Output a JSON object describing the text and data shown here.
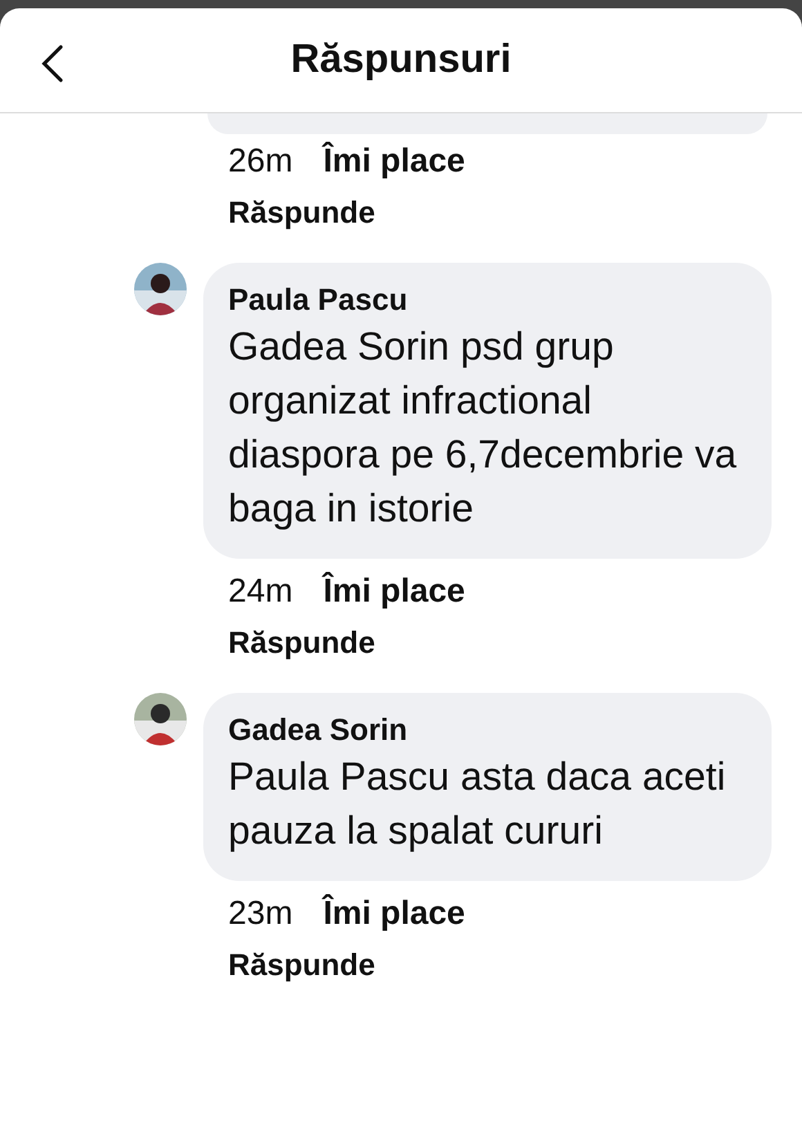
{
  "header": {
    "title": "Răspunsuri"
  },
  "previous": {
    "time": "26m",
    "like": "Îmi place",
    "reply": "Răspunde"
  },
  "comments": [
    {
      "author": "Paula Pascu",
      "text": "Gadea Sorin psd grup organizat infractional diaspora pe 6,7decembrie va baga in istorie",
      "time": "24m",
      "like": "Îmi place",
      "reply": "Răspunde"
    },
    {
      "author": "Gadea Sorin",
      "text": "Paula Pascu asta daca aceti pauza la spalat cururi",
      "time": "23m",
      "like": "Îmi place",
      "reply": "Răspunde"
    }
  ]
}
